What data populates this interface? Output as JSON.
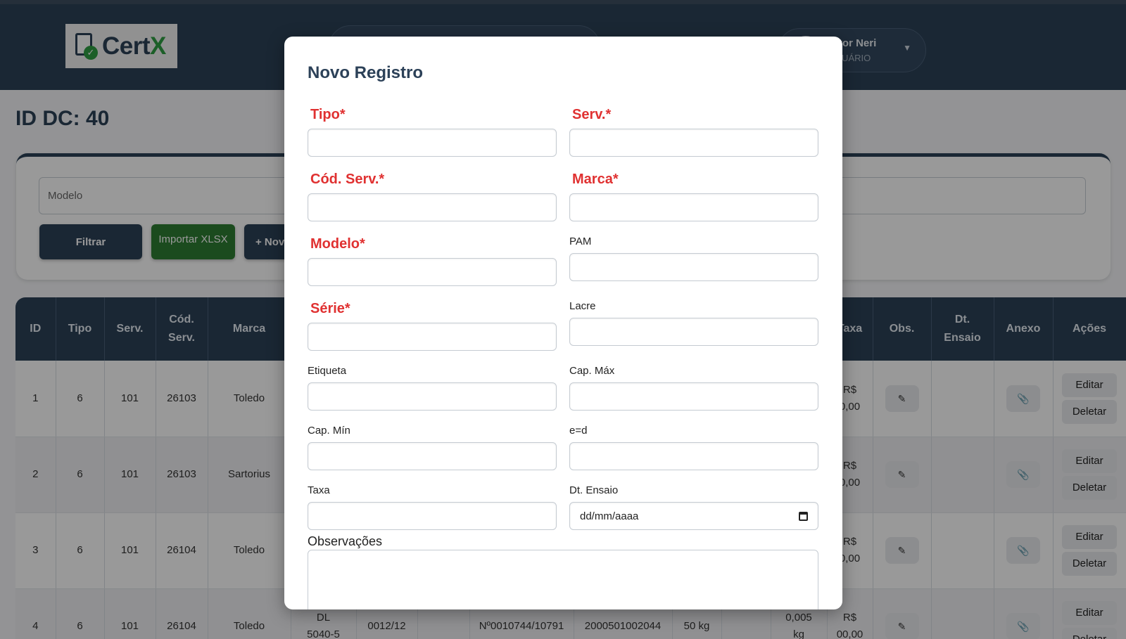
{
  "header": {
    "logo_text_a": "Cert",
    "logo_text_b": "X",
    "user_name": "Vitor Neri",
    "user_role": "USUÁRIO"
  },
  "page": {
    "title": "ID DC: 40",
    "filter_placeholder": "Modelo",
    "btn_filtrar": "Filtrar",
    "btn_importar": "Importar XLSX",
    "btn_novo": "+ Novo"
  },
  "table": {
    "headers": {
      "id": "ID",
      "tipo": "Tipo",
      "serv": "Serv.",
      "cod_a": "Cód.",
      "cod_b": "Serv.",
      "marca": "Marca",
      "taxa": "Taxa",
      "obs": "Obs.",
      "dt_a": "Dt.",
      "dt_b": "Ensaio",
      "anexo": "Anexo",
      "acoes": "Ações"
    },
    "rows": [
      {
        "id": "1",
        "tipo": "6",
        "serv": "101",
        "cod": "26103",
        "marca": "Toledo",
        "taxa_a": "R$",
        "taxa_b": "0,00"
      },
      {
        "id": "2",
        "tipo": "6",
        "serv": "101",
        "cod": "26103",
        "marca": "Sartorius",
        "taxa_a": "R$",
        "taxa_b": "0,00"
      },
      {
        "id": "3",
        "tipo": "6",
        "serv": "101",
        "cod": "26104",
        "marca": "Toledo",
        "taxa_a": "R$",
        "taxa_b": "0,00"
      },
      {
        "id": "4",
        "tipo": "6",
        "serv": "101",
        "cod": "26104",
        "marca": "Toledo",
        "modelo_a": "DL",
        "modelo_b": "5040-5",
        "pam": "0012/12",
        "serie": "Nº0010744/10791",
        "etiqueta": "2000501002044",
        "cap_max": "50 kg",
        "ed_a": "0,005",
        "ed_b": "kg",
        "taxa_a": "R$",
        "taxa_b": "00,00"
      }
    ],
    "btn_editar": "Editar",
    "btn_deletar": "Deletar",
    "obs_icon": "pencil-icon",
    "anexo_icon": "paperclip-icon"
  },
  "modal": {
    "title": "Novo Registro",
    "labels": {
      "tipo": "Tipo*",
      "serv": "Serv.*",
      "cod_serv": "Cód. Serv.*",
      "marca": "Marca*",
      "modelo": "Modelo*",
      "pam": "PAM",
      "serie": "Série*",
      "lacre": "Lacre",
      "etiqueta": "Etiqueta",
      "cap_max": "Cap. Máx",
      "cap_min": "Cap. Mín",
      "ed": "e=d",
      "taxa": "Taxa",
      "dt_ensaio": "Dt. Ensaio",
      "observacoes": "Observações"
    },
    "date_placeholder": "dd/mm/aaaa"
  },
  "colors": {
    "navy": "#2c4158",
    "required_red": "#e03131",
    "import_green": "#2e7d32"
  }
}
